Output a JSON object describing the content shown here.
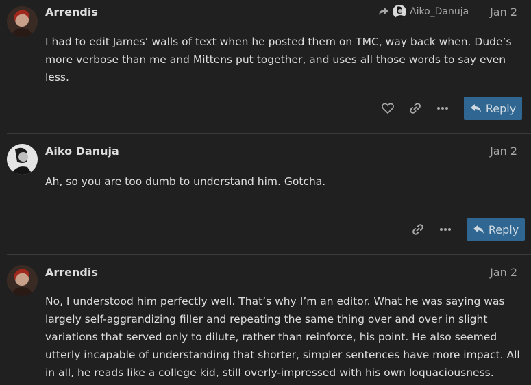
{
  "posts": [
    {
      "username": "Arrendis",
      "date": "Jan 2",
      "reply_to": "Aiko_Danuja",
      "body": "I had to edit James’ walls of text when he posted them on TMC, way back when. Dude’s more verbose than me and Mittens put together, and uses all those words to say even less.",
      "reply_label": "Reply"
    },
    {
      "username": "Aiko Danuja",
      "date": "Jan 2",
      "body": "Ah, so you are too dumb to understand him. Gotcha.",
      "reply_label": "Reply"
    },
    {
      "username": "Arrendis",
      "date": "Jan 2",
      "body": "No, I understood him perfectly well. That’s why I’m an editor. What he was saying was largely self-aggrandizing filler and repeating the same thing over and over in slight variations that served only to dilute, rather than reinforce, his point. He also seemed utterly incapable of understanding that shorter, simpler sentences have more impact. All in all, he reads like a college kid, still overly-impressed with his own loquaciousness."
    }
  ],
  "icons": [
    "heart-icon",
    "link-icon",
    "more-icon",
    "reply-icon",
    "reply-arrow-icon"
  ]
}
